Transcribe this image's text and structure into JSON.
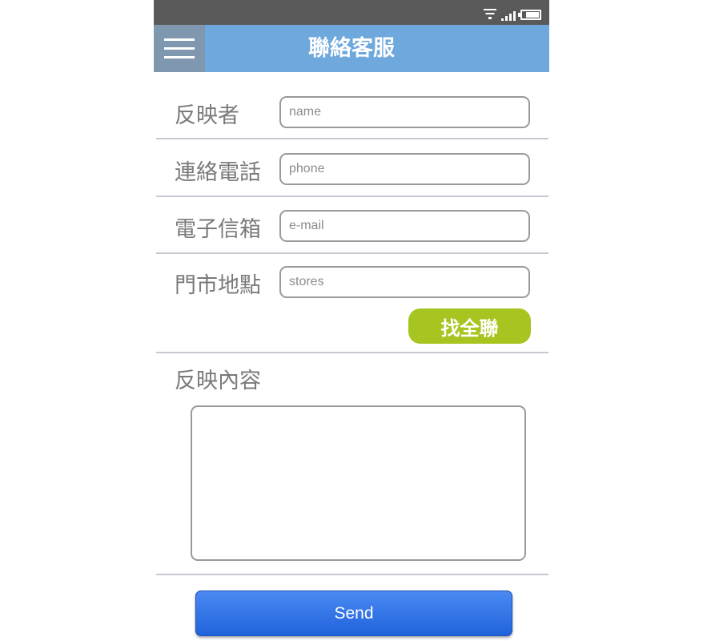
{
  "header": {
    "title": "聯絡客服",
    "menu_icon": "hamburger-menu-icon",
    "bar_color": "#6fa8dc"
  },
  "status_bar": {
    "icons": [
      "wifi-icon",
      "signal-icon",
      "battery-icon"
    ]
  },
  "form": {
    "reporter": {
      "label": "反映者",
      "placeholder": "name",
      "value": ""
    },
    "phone": {
      "label": "連絡電話",
      "placeholder": "phone",
      "value": ""
    },
    "email": {
      "label": "電子信箱",
      "placeholder": "e-mail",
      "value": ""
    },
    "store": {
      "label": "門市地點",
      "placeholder": "stores",
      "value": ""
    },
    "find_button_label": "找全聯",
    "content": {
      "label": "反映內容",
      "value": ""
    },
    "send_label": "Send"
  },
  "colors": {
    "accent_green": "#a7c520",
    "send_blue": "#2f72e6",
    "status_bar": "#595959"
  }
}
